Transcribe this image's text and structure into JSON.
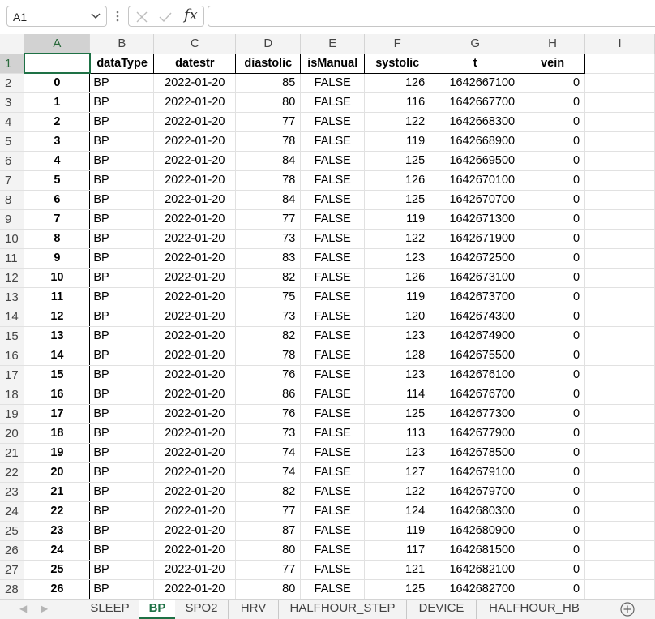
{
  "formula_bar": {
    "name_box": "A1",
    "dropdown_icon": "chevron-down-icon",
    "more_icon": "vertical-dots-icon",
    "cancel_icon": "x-icon",
    "enter_icon": "check-icon",
    "function_label": "fx",
    "formula_value": ""
  },
  "columns": [
    "A",
    "B",
    "C",
    "D",
    "E",
    "F",
    "G",
    "H",
    "I"
  ],
  "header_row": [
    "",
    "dataType",
    "datestr",
    "diastolic",
    "isManual",
    "systolic",
    "t",
    "vein"
  ],
  "rows": [
    [
      "0",
      "BP",
      "2022-01-20",
      "85",
      "FALSE",
      "126",
      "1642667100",
      "0"
    ],
    [
      "1",
      "BP",
      "2022-01-20",
      "80",
      "FALSE",
      "116",
      "1642667700",
      "0"
    ],
    [
      "2",
      "BP",
      "2022-01-20",
      "77",
      "FALSE",
      "122",
      "1642668300",
      "0"
    ],
    [
      "3",
      "BP",
      "2022-01-20",
      "78",
      "FALSE",
      "119",
      "1642668900",
      "0"
    ],
    [
      "4",
      "BP",
      "2022-01-20",
      "84",
      "FALSE",
      "125",
      "1642669500",
      "0"
    ],
    [
      "5",
      "BP",
      "2022-01-20",
      "78",
      "FALSE",
      "126",
      "1642670100",
      "0"
    ],
    [
      "6",
      "BP",
      "2022-01-20",
      "84",
      "FALSE",
      "125",
      "1642670700",
      "0"
    ],
    [
      "7",
      "BP",
      "2022-01-20",
      "77",
      "FALSE",
      "119",
      "1642671300",
      "0"
    ],
    [
      "8",
      "BP",
      "2022-01-20",
      "73",
      "FALSE",
      "122",
      "1642671900",
      "0"
    ],
    [
      "9",
      "BP",
      "2022-01-20",
      "83",
      "FALSE",
      "123",
      "1642672500",
      "0"
    ],
    [
      "10",
      "BP",
      "2022-01-20",
      "82",
      "FALSE",
      "126",
      "1642673100",
      "0"
    ],
    [
      "11",
      "BP",
      "2022-01-20",
      "75",
      "FALSE",
      "119",
      "1642673700",
      "0"
    ],
    [
      "12",
      "BP",
      "2022-01-20",
      "73",
      "FALSE",
      "120",
      "1642674300",
      "0"
    ],
    [
      "13",
      "BP",
      "2022-01-20",
      "82",
      "FALSE",
      "123",
      "1642674900",
      "0"
    ],
    [
      "14",
      "BP",
      "2022-01-20",
      "78",
      "FALSE",
      "128",
      "1642675500",
      "0"
    ],
    [
      "15",
      "BP",
      "2022-01-20",
      "76",
      "FALSE",
      "123",
      "1642676100",
      "0"
    ],
    [
      "16",
      "BP",
      "2022-01-20",
      "86",
      "FALSE",
      "114",
      "1642676700",
      "0"
    ],
    [
      "17",
      "BP",
      "2022-01-20",
      "76",
      "FALSE",
      "125",
      "1642677300",
      "0"
    ],
    [
      "18",
      "BP",
      "2022-01-20",
      "73",
      "FALSE",
      "113",
      "1642677900",
      "0"
    ],
    [
      "19",
      "BP",
      "2022-01-20",
      "74",
      "FALSE",
      "123",
      "1642678500",
      "0"
    ],
    [
      "20",
      "BP",
      "2022-01-20",
      "74",
      "FALSE",
      "127",
      "1642679100",
      "0"
    ],
    [
      "21",
      "BP",
      "2022-01-20",
      "82",
      "FALSE",
      "122",
      "1642679700",
      "0"
    ],
    [
      "22",
      "BP",
      "2022-01-20",
      "77",
      "FALSE",
      "124",
      "1642680300",
      "0"
    ],
    [
      "23",
      "BP",
      "2022-01-20",
      "87",
      "FALSE",
      "119",
      "1642680900",
      "0"
    ],
    [
      "24",
      "BP",
      "2022-01-20",
      "80",
      "FALSE",
      "117",
      "1642681500",
      "0"
    ],
    [
      "25",
      "BP",
      "2022-01-20",
      "77",
      "FALSE",
      "121",
      "1642682100",
      "0"
    ],
    [
      "26",
      "BP",
      "2022-01-20",
      "80",
      "FALSE",
      "125",
      "1642682700",
      "0"
    ]
  ],
  "sheet_nav": {
    "prev_icon": "arrow-left-icon",
    "next_icon": "arrow-right-icon",
    "prev": "◀",
    "next": "▶"
  },
  "sheet_tabs": [
    "SLEEP",
    "BP",
    "SPO2",
    "HRV",
    "HALFHOUR_STEP",
    "DEVICE",
    "HALFHOUR_HB"
  ],
  "active_sheet": "BP",
  "add_sheet_icon": "plus-circle-icon",
  "accent_color": "#1e7145"
}
